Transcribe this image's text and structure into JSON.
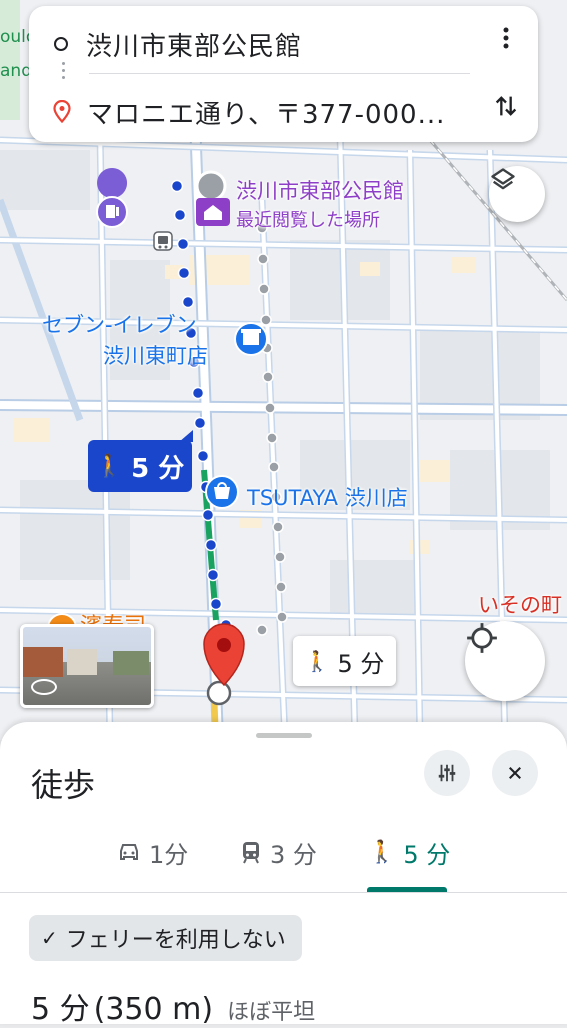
{
  "search": {
    "origin": "渋川市東部公民館",
    "destination": "マロニエ通り、〒377-000..."
  },
  "map": {
    "poi_destination_name": "渋川市東部公民館",
    "poi_destination_sub": "最近閲覧した場所",
    "poi_seven_line1": "セブン-イレブン",
    "poi_seven_line2": "渋川東町店",
    "poi_tsutaya": "TSUTAYA 渋川店",
    "poi_right_edge": "いその町",
    "poi_left_edge": "濱寿司",
    "edge_text_1": "oulo",
    "edge_text_2": "and",
    "route_badge_time": "5 分",
    "alt_route_time": "5 分"
  },
  "sheet": {
    "title": "徒歩",
    "tabs": [
      {
        "mode": "car-icon",
        "label": "1分"
      },
      {
        "mode": "transit-icon",
        "label": "3 分"
      },
      {
        "mode": "walk-icon",
        "label": "5 分"
      }
    ],
    "avoid_pill": "フェリーを利用しない",
    "summary_time": "5 分",
    "summary_distance": "(350 m)",
    "summary_terrain": "ほぼ平坦"
  },
  "colors": {
    "route_dots": "#1a46cc",
    "alt_route_dots": "#9aa0a6",
    "accent_teal": "#00796b",
    "poi_purple": "#8e3fc7",
    "poi_blue": "#1a73e8",
    "destination_pin": "#ea4335"
  }
}
